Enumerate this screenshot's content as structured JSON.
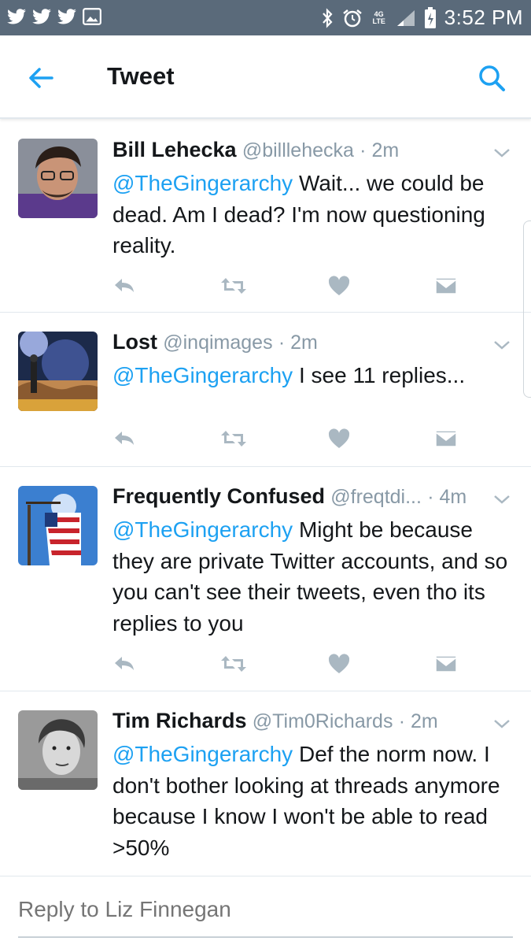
{
  "status_bar": {
    "time": "3:52 PM",
    "network": "4G LTE",
    "icons": [
      "twitter-icon",
      "twitter-icon",
      "twitter-icon",
      "image-icon",
      "bluetooth-icon",
      "alarm-icon",
      "network-4g-icon",
      "signal-icon",
      "battery-icon"
    ]
  },
  "header": {
    "title": "Tweet",
    "back_icon": "back-arrow-icon",
    "search_icon": "search-icon"
  },
  "tweets": [
    {
      "name": "Bill Lehecka",
      "handle": "@billlehecka",
      "time": "· 2m",
      "mention": "@TheGingerarchy",
      "text": " Wait... we could be dead. Am I dead? I'm now questioning reality."
    },
    {
      "name": "Lost",
      "handle": "@inqimages",
      "time": "· 2m",
      "mention": "@TheGingerarchy",
      "text": " I see 11 replies..."
    },
    {
      "name": "Frequently Confused",
      "handle": "@freqtdi...",
      "time": "· 4m",
      "mention": "@TheGingerarchy",
      "text": " Might be because they are private Twitter accounts, and so you can't see their tweets, even tho its replies to you"
    },
    {
      "name": "Tim Richards",
      "handle": "@Tim0Richards",
      "time": "· 2m",
      "mention": "@TheGingerarchy",
      "text": " Def the norm now. I don't bother looking at threads anymore because I know I won't be able to read >50%"
    }
  ],
  "reply": {
    "placeholder": "Reply to Liz Finnegan"
  },
  "colors": {
    "accent": "#1da1f2",
    "text": "#14171a",
    "muted": "#8899a6",
    "action_icon": "#aab8c2",
    "status_bar": "#5a6a7a"
  }
}
